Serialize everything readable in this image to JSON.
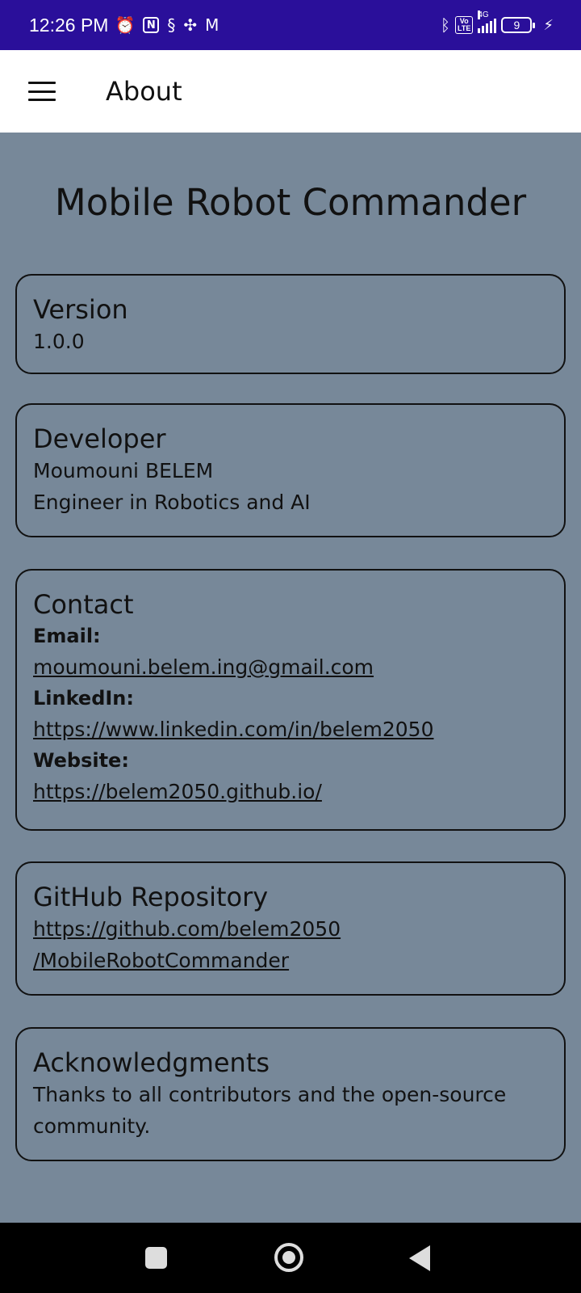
{
  "status_bar": {
    "time": "12:26 PM",
    "left_icons": [
      "alarm-icon",
      "nfc-icon",
      "s-app-icon",
      "fan-app-icon",
      "gmail-icon"
    ],
    "right_icons": [
      "bluetooth-icon",
      "volte-icon",
      "signal-icon",
      "battery-icon",
      "charging-icon"
    ],
    "volte_top": "Vo",
    "volte_bottom": "LTE",
    "network": "4G",
    "battery_level": "9"
  },
  "app_bar": {
    "title": "About",
    "menu_icon": "hamburger-menu-icon"
  },
  "page": {
    "title": "Mobile Robot Commander",
    "background_color": "#778899"
  },
  "version": {
    "title": "Version",
    "value": "1.0.0"
  },
  "developer": {
    "title": "Developer",
    "name": "Moumouni BELEM",
    "role": "Engineer in Robotics and AI"
  },
  "contact": {
    "title": "Contact",
    "email_label": "Email:",
    "email": "moumouni.belem.ing@gmail.com",
    "linkedin_label": "LinkedIn:",
    "linkedin": "https://www.linkedin.com/in/belem2050",
    "website_label": "Website:",
    "website": "https://belem2050.github.io/"
  },
  "github": {
    "title": "GitHub Repository",
    "link_line1": "https://github.com/belem2050",
    "link_line2": "/MobileRobotCommander"
  },
  "acknowledgments": {
    "title": "Acknowledgments",
    "line1": "Thanks to all contributors and the open-source",
    "line2": "community."
  },
  "nav_bar": {
    "icons": [
      "recents-square-icon",
      "home-circle-icon",
      "back-triangle-icon"
    ]
  }
}
